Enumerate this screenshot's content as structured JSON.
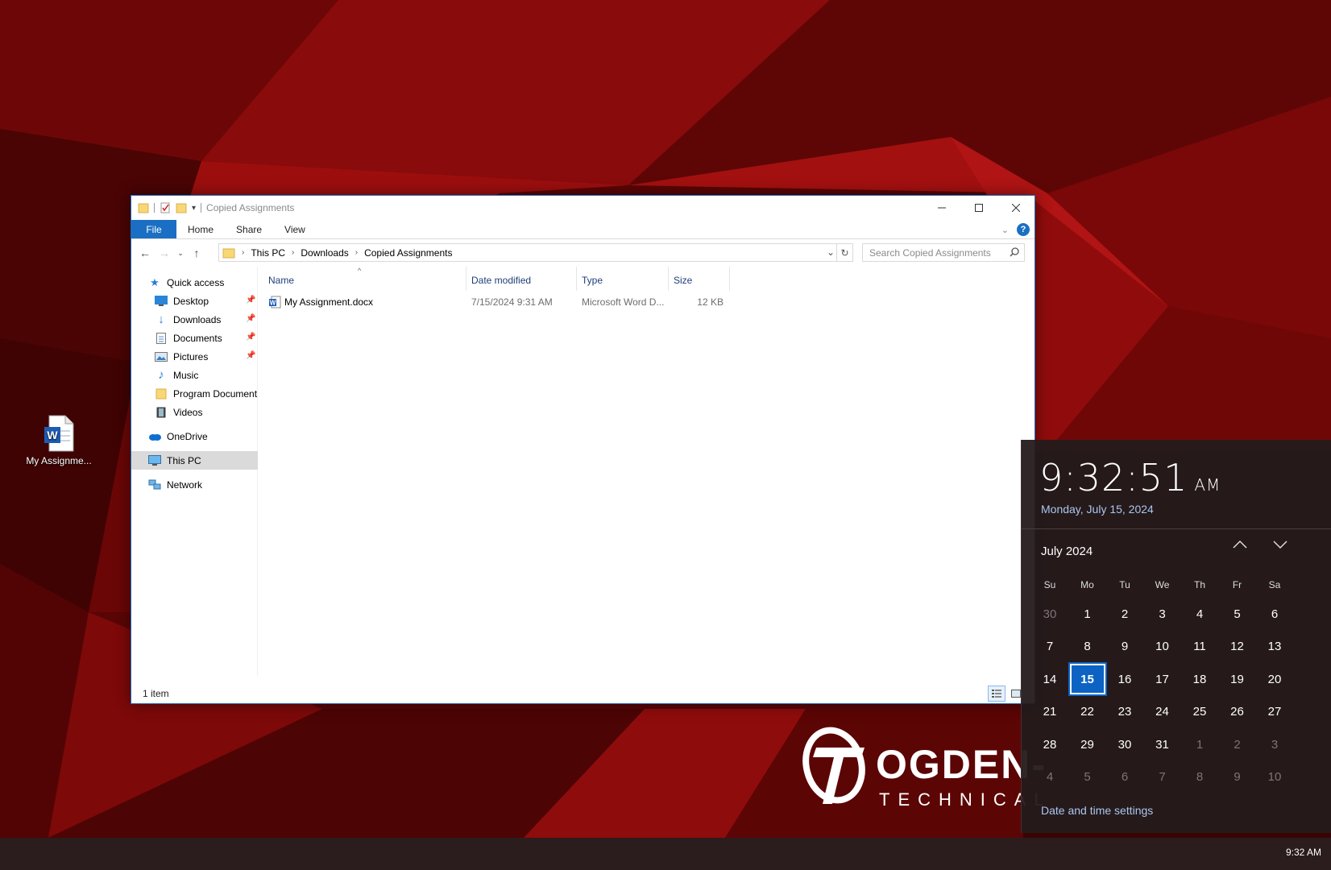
{
  "desktop": {
    "icon_label": "My Assignme...",
    "logo_name": "OGDEN-",
    "logo_sub": "TECHNICAL"
  },
  "explorer": {
    "title": "Copied Assignments",
    "tabs": [
      "File",
      "Home",
      "Share",
      "View"
    ],
    "address": {
      "crumbs": [
        "This PC",
        "Downloads",
        "Copied Assignments"
      ]
    },
    "search": {
      "placeholder": "Search Copied Assignments"
    },
    "nav": {
      "quick_access": "Quick access",
      "desktop": "Desktop",
      "downloads": "Downloads",
      "documents": "Documents",
      "pictures": "Pictures",
      "music": "Music",
      "program_documents": "Program Document",
      "videos": "Videos",
      "onedrive": "OneDrive",
      "this_pc": "This PC",
      "network": "Network"
    },
    "columns": {
      "name": "Name",
      "date": "Date modified",
      "type": "Type",
      "size": "Size"
    },
    "files": [
      {
        "name": "My Assignment.docx",
        "date": "7/15/2024 9:31 AM",
        "type": "Microsoft Word D...",
        "size": "12 KB"
      }
    ],
    "status": "1 item"
  },
  "clock_flyout": {
    "time": "9:32:51",
    "ampm": "AM",
    "date": "Monday, July 15, 2024",
    "month_label": "July 2024",
    "weekdays": [
      "Su",
      "Mo",
      "Tu",
      "We",
      "Th",
      "Fr",
      "Sa"
    ],
    "days": [
      [
        "30",
        "1",
        "2",
        "3",
        "4",
        "5",
        "6"
      ],
      [
        "7",
        "8",
        "9",
        "10",
        "11",
        "12",
        "13"
      ],
      [
        "14",
        "15",
        "16",
        "17",
        "18",
        "19",
        "20"
      ],
      [
        "21",
        "22",
        "23",
        "24",
        "25",
        "26",
        "27"
      ],
      [
        "28",
        "29",
        "30",
        "31",
        "1",
        "2",
        "3"
      ],
      [
        "4",
        "5",
        "6",
        "7",
        "8",
        "9",
        "10"
      ]
    ],
    "today": "15",
    "settings_link": "Date and time settings"
  },
  "taskbar": {
    "clock": "9:32 AM"
  }
}
